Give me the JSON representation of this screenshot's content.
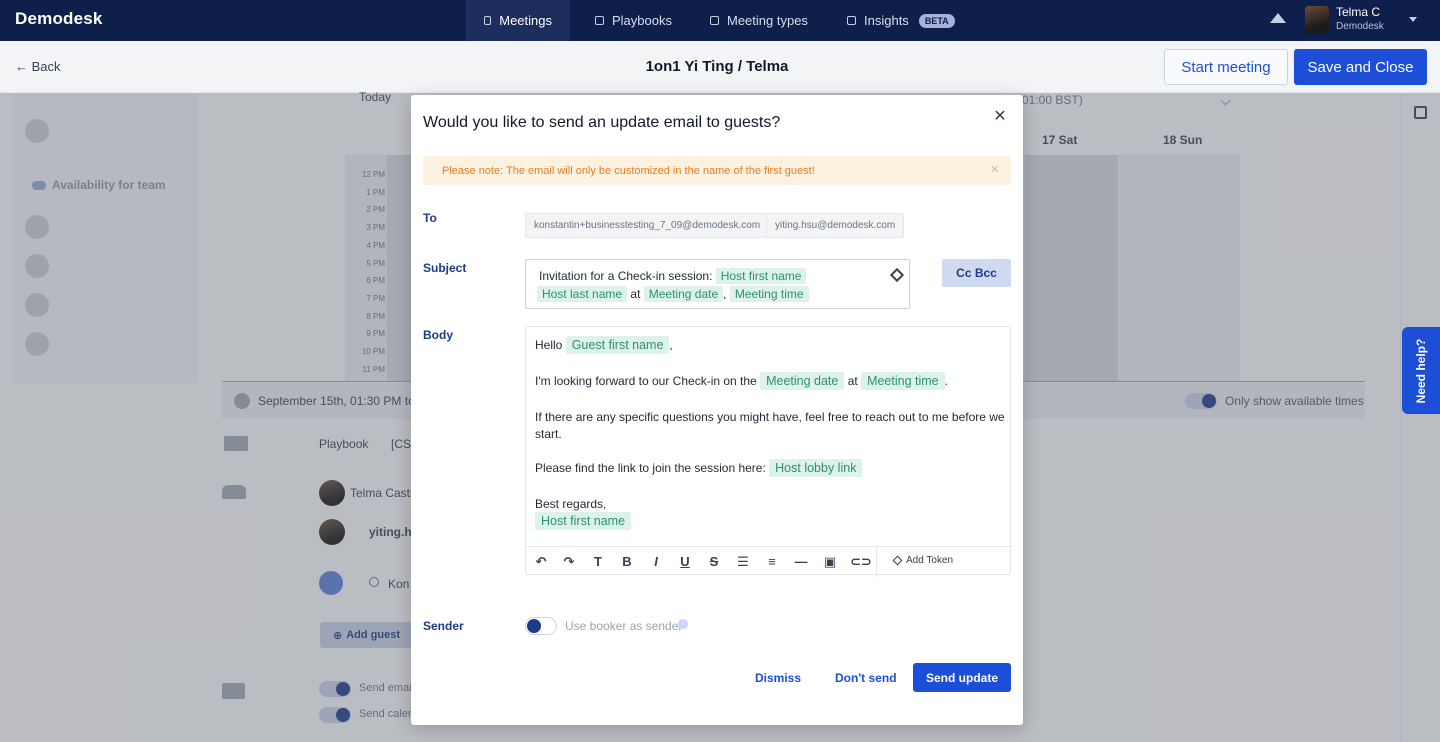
{
  "app": {
    "logo": "Demodesk"
  },
  "nav": {
    "tabs": [
      {
        "label": "Meetings",
        "active": true
      },
      {
        "label": "Playbooks",
        "active": false
      },
      {
        "label": "Meeting types",
        "active": false
      },
      {
        "label": "Insights",
        "active": false,
        "badge": "BETA"
      }
    ],
    "user": {
      "name": "Telma C",
      "org": "Demodesk"
    }
  },
  "header": {
    "back": "Back",
    "title": "1on1 Yi Ting / Telma",
    "start_meeting": "Start meeting",
    "save_close": "Save and Close"
  },
  "background": {
    "calendar": {
      "today": "Today",
      "timezone_suffix": "01:00 BST)",
      "days": [
        "17 Sat",
        "18 Sun"
      ],
      "hours": [
        "12 PM",
        "1 PM",
        "2 PM",
        "3 PM",
        "4 PM",
        "5 PM",
        "6 PM",
        "7 PM",
        "8 PM",
        "9 PM",
        "10 PM",
        "11 PM"
      ]
    },
    "sidebar": {
      "team_label": "Availability for team"
    },
    "date_text": "September 15th, 01:30 PM to 0",
    "only_available": "Only show available times",
    "playbook_label": "Playbook",
    "playbook_value": "[CS]",
    "guests": [
      {
        "name": "Telma Castr"
      },
      {
        "name": "yiting.hs"
      }
    ],
    "search_partial": "Kon",
    "add_guest": "Add guest",
    "send_email_partial": "Send emai",
    "send_calendar_partial": "Send calen",
    "need_help": "Need help?"
  },
  "modal": {
    "title": "Would you like to send an update email to guests?",
    "notice": "Please note: The email will only be customized in the name of the first guest!",
    "to_label": "To",
    "to": [
      "konstantin+businesstesting_7_09@demodesk.com",
      "yiting.hsu@demodesk.com"
    ],
    "subject_label": "Subject",
    "subject": {
      "prefix": "Invitation for a Check-in session:",
      "token_host_first": "Host first name",
      "token_host_last": "Host last name",
      "at": "at",
      "token_date": "Meeting date",
      "comma": ",",
      "token_time": "Meeting time"
    },
    "cc_bcc": "Cc Bcc",
    "body_label": "Body",
    "body": {
      "hello": "Hello",
      "token_guest_first": "Guest first name",
      "comma": ",",
      "line2_prefix": "I'm looking forward to our Check-in on the",
      "token_date": "Meeting date",
      "at": "at",
      "token_time": "Meeting time",
      "period": ".",
      "line3a": "If there are any specific questions you might have, feel free to reach out to me before we",
      "line3b": "start.",
      "line4_prefix": "Please find the link to join the session here:",
      "token_lobby": "Host lobby link",
      "regards": "Best regards,",
      "token_host_first": "Host first name"
    },
    "toolbar": {
      "icons": [
        "undo-icon",
        "redo-icon",
        "text-size-icon",
        "bold-icon",
        "italic-icon",
        "underline-icon",
        "strikethrough-icon",
        "bullet-list-icon",
        "numbered-list-icon",
        "horizontal-rule-icon",
        "image-icon",
        "link-icon"
      ],
      "add_token": "Add Token"
    },
    "sender_label": "Sender",
    "use_booker": "Use booker as sender",
    "dismiss": "Dismiss",
    "dont_send": "Don't send",
    "send_update": "Send update"
  }
}
